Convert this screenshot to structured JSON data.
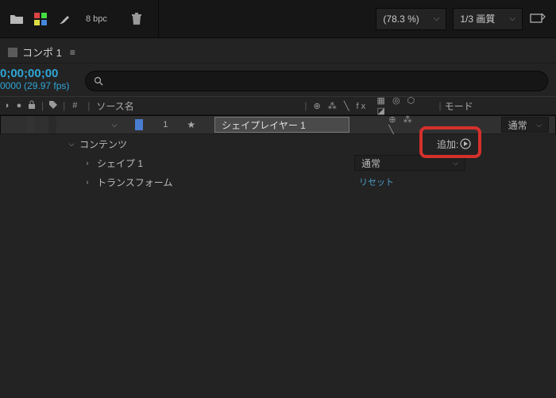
{
  "topbar": {
    "bpc": "8 bpc",
    "zoom": "(78.3 %)",
    "resolution": "1/3 画質"
  },
  "tab": {
    "name": "コンポ 1"
  },
  "timecode": {
    "main": "0;00;00;00",
    "sub": "0000 (29.97 fps)"
  },
  "search": {
    "placeholder": ""
  },
  "columns": {
    "hash": "#",
    "sourceName": "ソース名",
    "mode": "モード"
  },
  "layer": {
    "num": "1",
    "name": "シェイプレイヤー 1",
    "mode": "通常"
  },
  "contents": {
    "label": "コンテンツ",
    "add": "追加:",
    "shape": {
      "label": "シェイプ 1",
      "mode": "通常"
    },
    "transform": {
      "label": "トランスフォーム",
      "reset": "リセット"
    }
  }
}
